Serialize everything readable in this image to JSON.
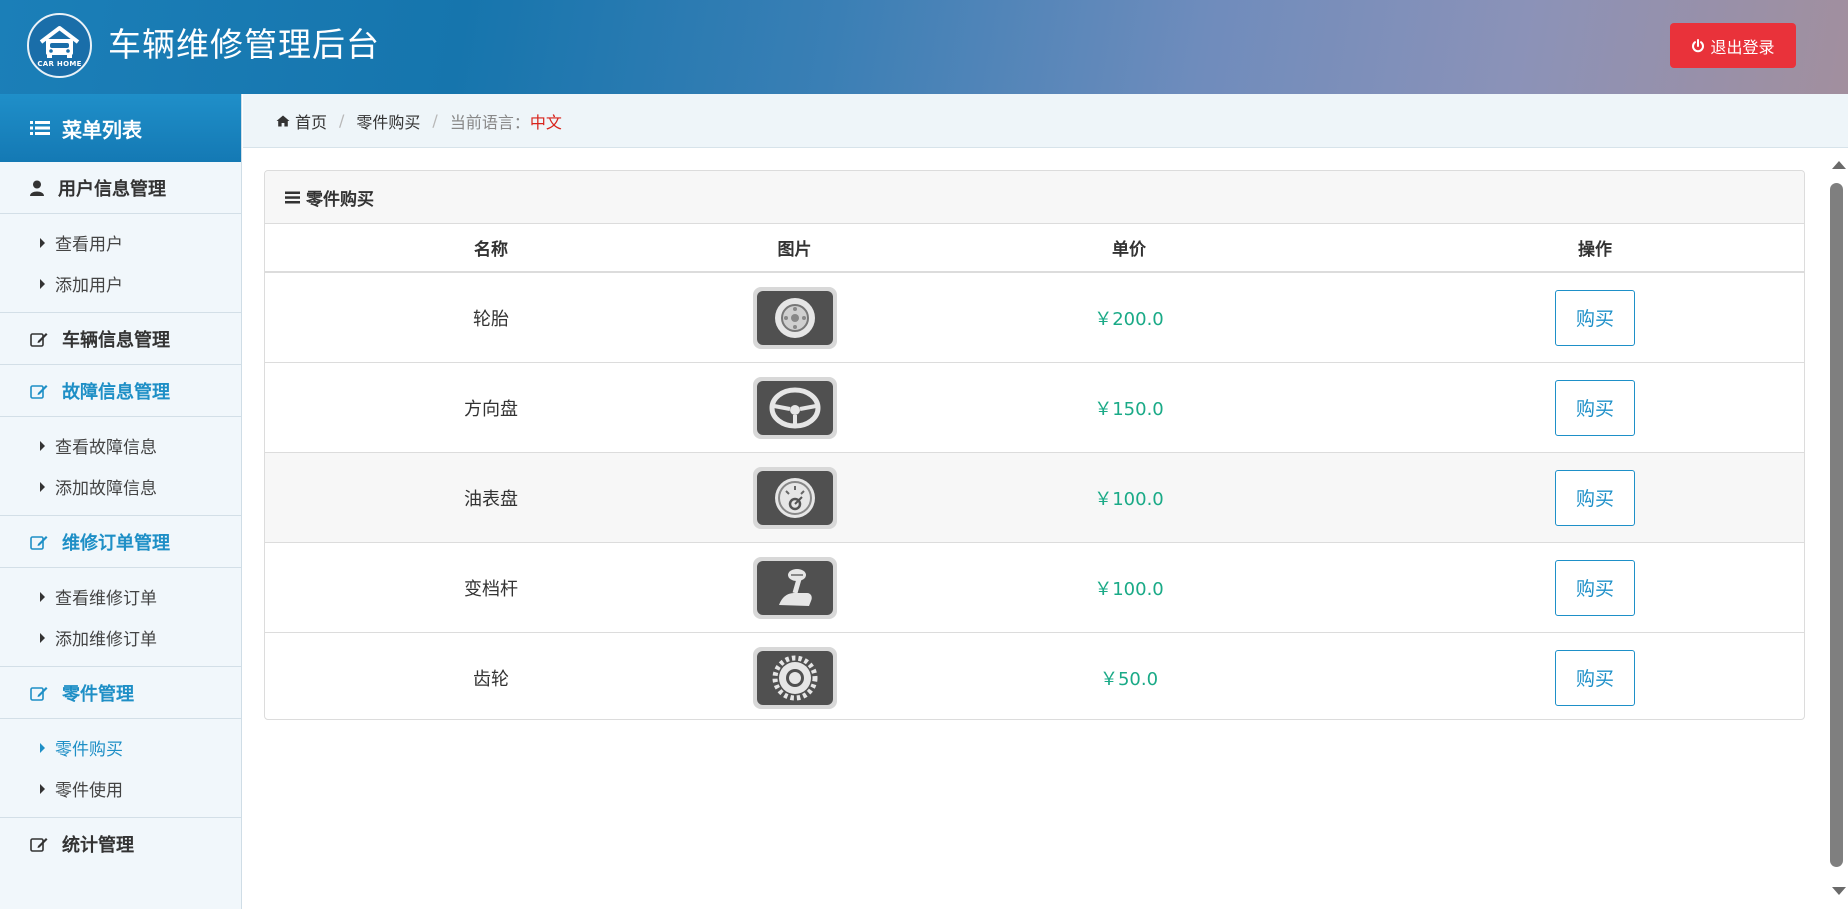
{
  "header": {
    "logo_text": "CAR HOME",
    "app_title": "车辆维修管理后台",
    "logout_label": "退出登录"
  },
  "sidebar": {
    "menu_title": "菜单列表",
    "sections": [
      {
        "label": "用户信息管理",
        "items": [
          "查看用户",
          "添加用户"
        ]
      },
      {
        "label": "车辆信息管理",
        "items": []
      },
      {
        "label": "故障信息管理",
        "items": [
          "查看故障信息",
          "添加故障信息"
        ]
      },
      {
        "label": "维修订单管理",
        "items": [
          "查看维修订单",
          "添加维修订单"
        ]
      },
      {
        "label": "零件管理",
        "items": [
          "零件购买",
          "零件使用"
        ]
      },
      {
        "label": "统计管理",
        "items": []
      }
    ],
    "active_item": "零件购买"
  },
  "breadcrumb": {
    "home": "首页",
    "current": "零件购买",
    "lang_label": "当前语言：",
    "lang_value": "中文"
  },
  "panel": {
    "title": "零件购买",
    "columns": [
      "名称",
      "图片",
      "单价",
      "操作"
    ],
    "buy_label": "购买",
    "rows": [
      {
        "name": "轮胎",
        "icon": "tire-icon",
        "price": "￥200.0"
      },
      {
        "name": "方向盘",
        "icon": "steering-wheel-icon",
        "price": "￥150.0"
      },
      {
        "name": "油表盘",
        "icon": "fuel-gauge-icon",
        "price": "￥100.0"
      },
      {
        "name": "变档杆",
        "icon": "gear-shift-icon",
        "price": "￥100.0"
      },
      {
        "name": "齿轮",
        "icon": "gear-icon",
        "price": "￥50.0"
      }
    ]
  },
  "colors": {
    "accent": "#1e8fc6",
    "logout": "#e9323a",
    "price": "#1aaa87",
    "lang_value": "#d8231b"
  }
}
